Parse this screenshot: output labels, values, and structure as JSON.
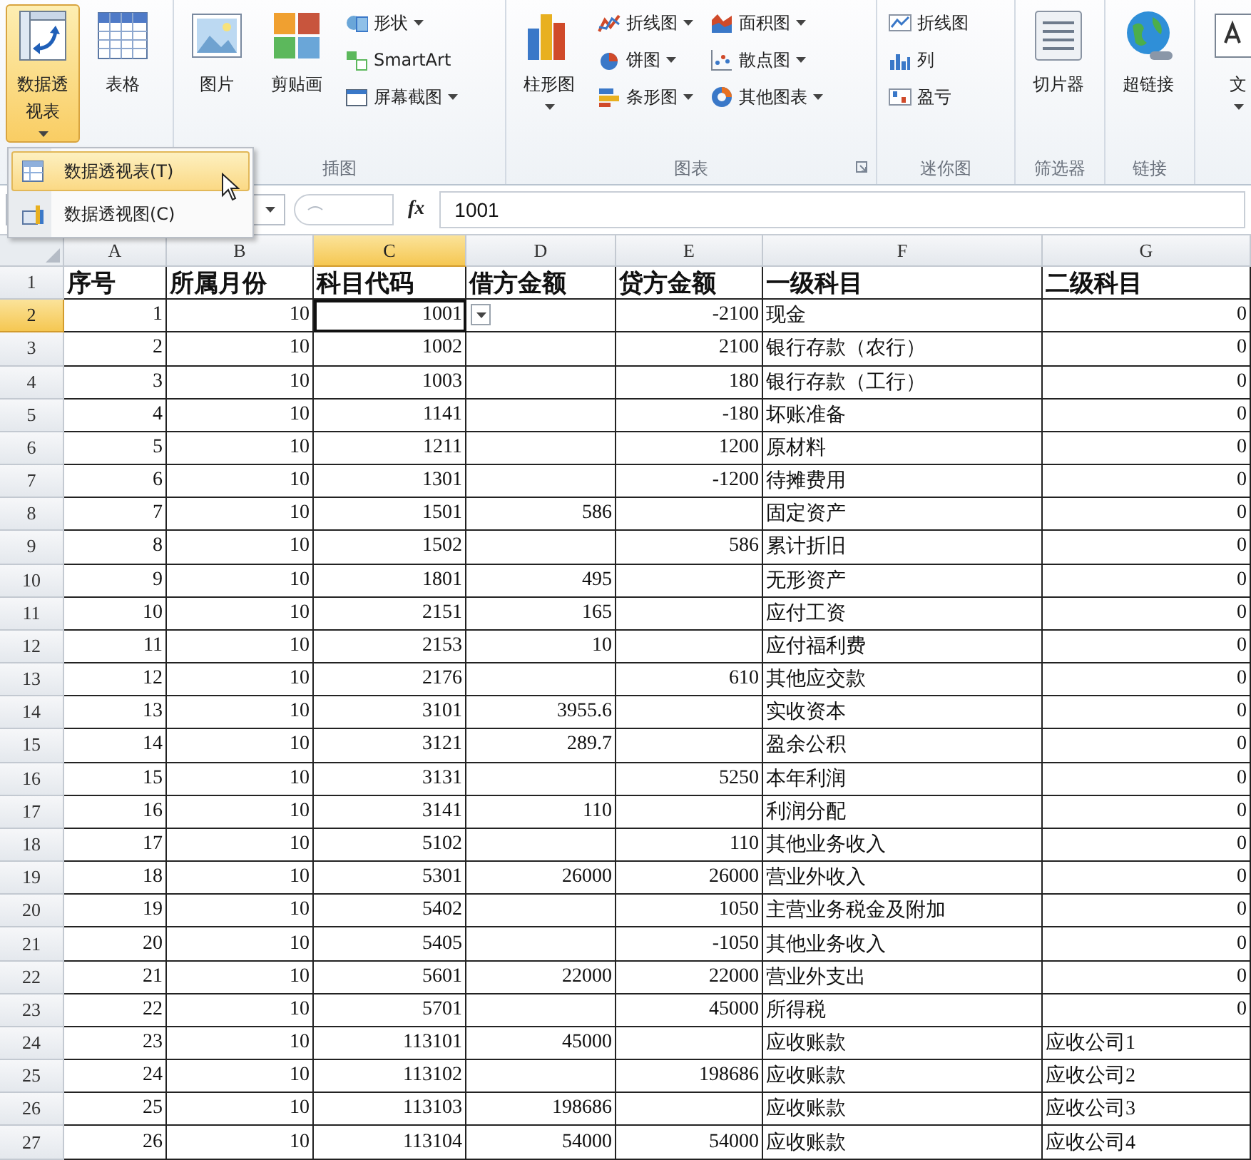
{
  "ribbon": {
    "groups": [
      {
        "items": [
          {
            "label": "数据透视表",
            "kind": "large",
            "pressed": true,
            "dropdown": true
          },
          {
            "label": "表格",
            "kind": "large",
            "pressed": false,
            "dropdown": false
          }
        ]
      },
      {
        "label": "插图",
        "items": [
          {
            "label": "图片",
            "kind": "large",
            "pressed": false,
            "dropdown": false
          },
          {
            "label": "剪贴画",
            "kind": "large",
            "pressed": false,
            "dropdown": false
          },
          {
            "label": "形状",
            "kind": "small",
            "pressed": false,
            "dropdown": true
          },
          {
            "label": "SmartArt",
            "kind": "small",
            "pressed": false,
            "dropdown": false
          },
          {
            "label": "屏幕截图",
            "kind": "small",
            "pressed": false,
            "dropdown": true
          }
        ]
      },
      {
        "label": "图表",
        "launcher": true,
        "items": [
          {
            "label": "柱形图",
            "kind": "large",
            "pressed": false,
            "dropdown": true
          },
          {
            "label": "折线图",
            "kind": "small",
            "pressed": false,
            "dropdown": true
          },
          {
            "label": "饼图",
            "kind": "small",
            "pressed": false,
            "dropdown": true
          },
          {
            "label": "条形图",
            "kind": "small",
            "pressed": false,
            "dropdown": true
          },
          {
            "label": "面积图",
            "kind": "small",
            "pressed": false,
            "dropdown": true
          },
          {
            "label": "散点图",
            "kind": "small",
            "pressed": false,
            "dropdown": true
          },
          {
            "label": "其他图表",
            "kind": "small",
            "pressed": false,
            "dropdown": true
          }
        ]
      },
      {
        "label": "迷你图",
        "items": [
          {
            "label": "折线图",
            "kind": "small",
            "pressed": false,
            "dropdown": false
          },
          {
            "label": "列",
            "kind": "small",
            "pressed": false,
            "dropdown": false
          },
          {
            "label": "盈亏",
            "kind": "small",
            "pressed": false,
            "dropdown": false
          }
        ]
      },
      {
        "label": "筛选器",
        "items": [
          {
            "label": "切片器",
            "kind": "large",
            "pressed": false,
            "dropdown": false
          }
        ]
      },
      {
        "label": "链接",
        "items": [
          {
            "label": "超链接",
            "kind": "large",
            "pressed": false,
            "dropdown": false
          }
        ]
      },
      {
        "items": [
          {
            "label": "文",
            "kind": "large",
            "pressed": false,
            "dropdown": true
          }
        ]
      }
    ]
  },
  "menu": {
    "items": [
      {
        "label": "数据透视表(T)",
        "selected": true
      },
      {
        "label": "数据透视图(C)",
        "selected": false
      }
    ]
  },
  "formula_bar": {
    "function_button": "fx",
    "value": "1001"
  },
  "sheet": {
    "columns": [
      {
        "label": "A",
        "selected": false
      },
      {
        "label": "B",
        "selected": false
      },
      {
        "label": "C",
        "selected": true
      },
      {
        "label": "D",
        "selected": false
      },
      {
        "label": "E",
        "selected": false
      },
      {
        "label": "F",
        "selected": false
      },
      {
        "label": "G",
        "selected": false
      }
    ],
    "rows": [
      {
        "number": "1",
        "selected": false,
        "kind": "header",
        "cells": [
          "序号",
          "所属月份",
          "科目代码",
          "借方金额",
          "贷方金额",
          "一级科目",
          "二级科目"
        ]
      },
      {
        "number": "2",
        "selected": true,
        "kind": "data",
        "cells": [
          "1",
          "10",
          "1001",
          null,
          "-2100",
          "现金",
          "0"
        ]
      },
      {
        "number": "3",
        "selected": false,
        "kind": "data",
        "cells": [
          "2",
          "10",
          "1002",
          null,
          "2100",
          "银行存款（农行）",
          "0"
        ]
      },
      {
        "number": "4",
        "selected": false,
        "kind": "data",
        "cells": [
          "3",
          "10",
          "1003",
          null,
          "180",
          "银行存款（工行）",
          "0"
        ]
      },
      {
        "number": "5",
        "selected": false,
        "kind": "data",
        "cells": [
          "4",
          "10",
          "1141",
          null,
          "-180",
          "坏账准备",
          "0"
        ]
      },
      {
        "number": "6",
        "selected": false,
        "kind": "data",
        "cells": [
          "5",
          "10",
          "1211",
          null,
          "1200",
          "原材料",
          "0"
        ]
      },
      {
        "number": "7",
        "selected": false,
        "kind": "data",
        "cells": [
          "6",
          "10",
          "1301",
          null,
          "-1200",
          "待摊费用",
          "0"
        ]
      },
      {
        "number": "8",
        "selected": false,
        "kind": "data",
        "cells": [
          "7",
          "10",
          "1501",
          "586",
          null,
          "固定资产",
          "0"
        ]
      },
      {
        "number": "9",
        "selected": false,
        "kind": "data",
        "cells": [
          "8",
          "10",
          "1502",
          null,
          "586",
          "累计折旧",
          "0"
        ]
      },
      {
        "number": "10",
        "selected": false,
        "kind": "data",
        "cells": [
          "9",
          "10",
          "1801",
          "495",
          null,
          "无形资产",
          "0"
        ]
      },
      {
        "number": "11",
        "selected": false,
        "kind": "data",
        "cells": [
          "10",
          "10",
          "2151",
          "165",
          null,
          "应付工资",
          "0"
        ]
      },
      {
        "number": "12",
        "selected": false,
        "kind": "data",
        "cells": [
          "11",
          "10",
          "2153",
          "10",
          null,
          "应付福利费",
          "0"
        ]
      },
      {
        "number": "13",
        "selected": false,
        "kind": "data",
        "cells": [
          "12",
          "10",
          "2176",
          null,
          "610",
          "其他应交款",
          "0"
        ]
      },
      {
        "number": "14",
        "selected": false,
        "kind": "data",
        "cells": [
          "13",
          "10",
          "3101",
          "3955.6",
          null,
          "实收资本",
          "0"
        ]
      },
      {
        "number": "15",
        "selected": false,
        "kind": "data",
        "cells": [
          "14",
          "10",
          "3121",
          "289.7",
          null,
          "盈余公积",
          "0"
        ]
      },
      {
        "number": "16",
        "selected": false,
        "kind": "data",
        "cells": [
          "15",
          "10",
          "3131",
          null,
          "5250",
          "本年利润",
          "0"
        ]
      },
      {
        "number": "17",
        "selected": false,
        "kind": "data",
        "cells": [
          "16",
          "10",
          "3141",
          "110",
          null,
          "利润分配",
          "0"
        ]
      },
      {
        "number": "18",
        "selected": false,
        "kind": "data",
        "cells": [
          "17",
          "10",
          "5102",
          null,
          "110",
          "其他业务收入",
          "0"
        ]
      },
      {
        "number": "19",
        "selected": false,
        "kind": "data",
        "cells": [
          "18",
          "10",
          "5301",
          "26000",
          "26000",
          "营业外收入",
          "0"
        ]
      },
      {
        "number": "20",
        "selected": false,
        "kind": "data",
        "cells": [
          "19",
          "10",
          "5402",
          null,
          "1050",
          "主营业务税金及附加",
          "0"
        ]
      },
      {
        "number": "21",
        "selected": false,
        "kind": "data",
        "cells": [
          "20",
          "10",
          "5405",
          null,
          "-1050",
          "其他业务收入",
          "0"
        ]
      },
      {
        "number": "22",
        "selected": false,
        "kind": "data",
        "cells": [
          "21",
          "10",
          "5601",
          "22000",
          "22000",
          "营业外支出",
          "0"
        ]
      },
      {
        "number": "23",
        "selected": false,
        "kind": "data",
        "cells": [
          "22",
          "10",
          "5701",
          null,
          "45000",
          "所得税",
          "0"
        ]
      },
      {
        "number": "24",
        "selected": false,
        "kind": "data",
        "cells": [
          "23",
          "10",
          "113101",
          "45000",
          null,
          "应收账款",
          "应收公司1"
        ]
      },
      {
        "number": "25",
        "selected": false,
        "kind": "data",
        "cells": [
          "24",
          "10",
          "113102",
          null,
          "198686",
          "应收账款",
          "应收公司2"
        ]
      },
      {
        "number": "26",
        "selected": false,
        "kind": "data",
        "cells": [
          "25",
          "10",
          "113103",
          "198686",
          null,
          "应收账款",
          "应收公司3"
        ]
      },
      {
        "number": "27",
        "selected": false,
        "kind": "data",
        "cells": [
          "26",
          "10",
          "113104",
          "54000",
          "54000",
          "应收账款",
          "应收公司4"
        ]
      }
    ]
  }
}
